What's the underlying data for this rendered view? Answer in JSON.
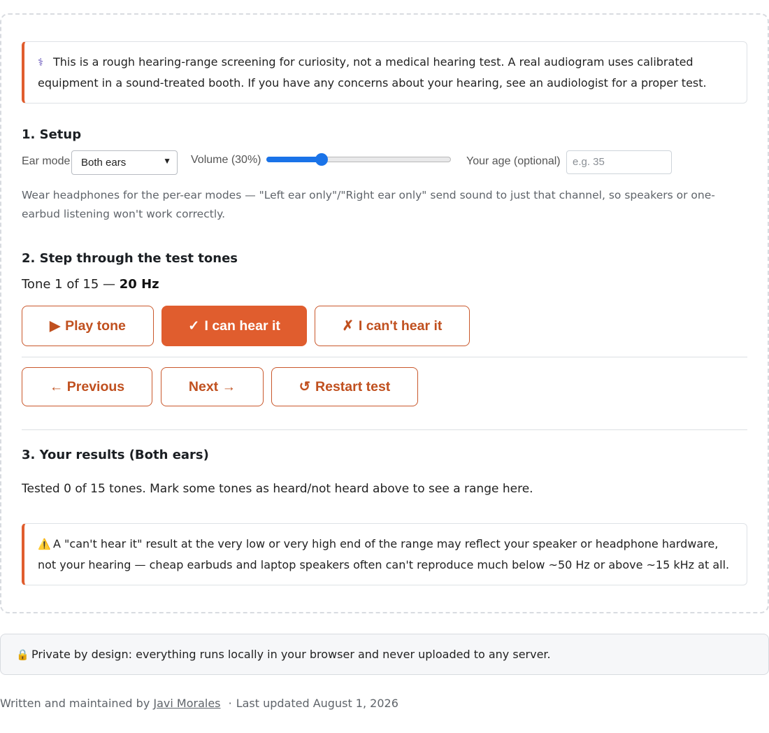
{
  "disclaimer": {
    "icon": "stethoscope-icon",
    "text": "This is a rough hearing-range screening for curiosity, not a medical hearing test. A real audiogram uses calibrated equipment in a sound-treated booth. If you have any concerns about your hearing, see an audiologist for a proper test."
  },
  "setup": {
    "heading": "1. Setup",
    "ear_mode_label": "Ear mode",
    "ear_mode_value": "Both ears",
    "volume_label": "Volume (30%)",
    "volume_level": 0.3,
    "age_label": "Your age (optional)",
    "age_placeholder": "e.g. 35",
    "hint": "Wear headphones for the per-ear modes — \"Left ear only\"/\"Right ear only\" send sound to just that channel, so speakers or one-earbud listening won't work correctly."
  },
  "step": {
    "heading": "2. Step through the test tones",
    "tone_prefix": "Tone 1 of 15 — ",
    "tone_freq": "20 Hz",
    "play_icon": "▶",
    "play_label": "Play tone",
    "hear_icon": "✓",
    "hear_label": "I can hear it",
    "cant_icon": "✗",
    "cant_label": "I can't hear it",
    "prev_label": "← Previous",
    "next_label": "Next →",
    "restart_icon": "↺",
    "restart_label": "Restart test"
  },
  "results": {
    "heading": "3. Your results (Both ears)",
    "text": "Tested 0 of 15 tones. Mark some tones as heard/not heard above to see a range here."
  },
  "warning": {
    "icon": "warning-icon",
    "text": "A \"can't hear it\" result at the very low or very high end of the range may reflect your speaker or headphone hardware, not your hearing — cheap earbuds and laptop speakers often can't reproduce much below ~50 Hz or above ~15 kHz at all."
  },
  "privacy": {
    "icon": "lock-icon",
    "text": "Private by design: everything runs locally in your browser and never uploaded to any server."
  },
  "footer": {
    "prefix": "Written and maintained by",
    "author": "Javi Morales",
    "separator": "·",
    "updated": "Last updated August 1, 2026"
  },
  "colors": {
    "accent": "#e05d2e",
    "slider": "#1a73e8"
  }
}
